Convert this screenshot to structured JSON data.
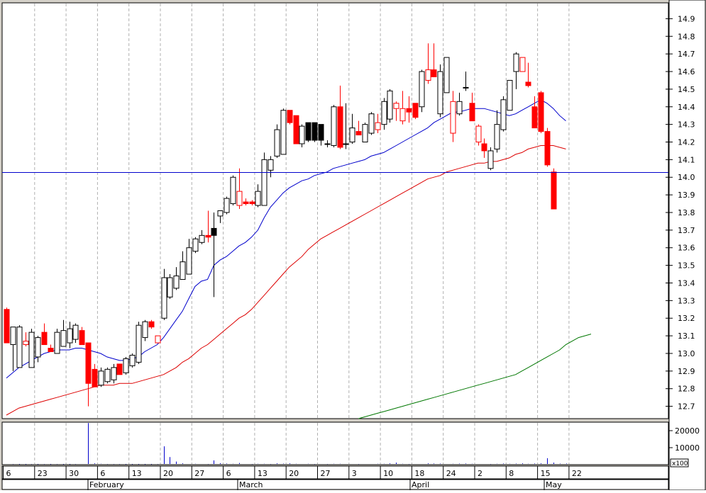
{
  "chart_data": {
    "type": "candlestick",
    "title": "",
    "grid": true,
    "price_axis": {
      "ylim": [
        12.63,
        14.99
      ],
      "ticks": [
        "14.9",
        "14.8",
        "14.7",
        "14.6",
        "14.5",
        "14.4",
        "14.3",
        "14.2",
        "14.1",
        "14.0",
        "13.9",
        "13.8",
        "13.7",
        "13.6",
        "13.5",
        "13.4",
        "13.3",
        "13.2",
        "13.1",
        "13.0",
        "12.9",
        "12.8",
        "12.7"
      ]
    },
    "volume_axis": {
      "ylim": [
        0,
        25000
      ],
      "ticks": [
        "20000",
        "10000"
      ],
      "multiplier_label": "x100"
    },
    "date_ticks": [
      "6",
      "23",
      "30",
      "6",
      "13",
      "20",
      "27",
      "6",
      "13",
      "20",
      "27",
      "3",
      "10",
      "18",
      "24",
      "2",
      "8",
      "15",
      "22"
    ],
    "month_labels": [
      "February",
      "March",
      "April",
      "May"
    ],
    "reference_line": {
      "value": 14.03,
      "color": "#0000cc"
    },
    "colors": {
      "up_candle": "#000000",
      "down_candle": "#ff0000",
      "ma_short": "#0000cc",
      "ma_mid": "#dd0000",
      "ma_long": "#007700",
      "volume": "#0000cc"
    },
    "candles": [
      {
        "o": 13.25,
        "h": 13.26,
        "l": 13.06,
        "c": 13.06,
        "col": "red",
        "fill": true
      },
      {
        "o": 13.05,
        "h": 13.15,
        "l": 12.9,
        "c": 13.15,
        "col": "black",
        "fill": false
      },
      {
        "o": 12.92,
        "h": 13.16,
        "l": 12.92,
        "c": 13.15,
        "col": "black",
        "fill": false
      },
      {
        "o": 13.07,
        "h": 13.12,
        "l": 13.04,
        "c": 13.05,
        "col": "red",
        "fill": false
      },
      {
        "o": 13.12,
        "h": 13.14,
        "l": 12.92,
        "c": 12.92,
        "col": "black",
        "fill": false
      },
      {
        "o": 12.98,
        "h": 13.1,
        "l": 12.95,
        "c": 13.09,
        "col": "black",
        "fill": false
      },
      {
        "o": 13.12,
        "h": 13.17,
        "l": 13.05,
        "c": 13.05,
        "col": "red",
        "fill": true
      },
      {
        "o": 13.03,
        "h": 13.05,
        "l": 13.01,
        "c": 13.01,
        "col": "red",
        "fill": true
      },
      {
        "o": 13.0,
        "h": 13.14,
        "l": 13.0,
        "c": 13.12,
        "col": "black",
        "fill": false
      },
      {
        "o": 13.04,
        "h": 13.19,
        "l": 13.04,
        "c": 13.13,
        "col": "black",
        "fill": false
      },
      {
        "o": 13.06,
        "h": 13.18,
        "l": 13.03,
        "c": 13.14,
        "col": "black",
        "fill": false
      },
      {
        "o": 13.08,
        "h": 13.17,
        "l": 13.06,
        "c": 13.16,
        "col": "black",
        "fill": false
      },
      {
        "o": 13.13,
        "h": 13.15,
        "l": 13.05,
        "c": 13.05,
        "col": "red",
        "fill": true
      },
      {
        "o": 13.06,
        "h": 13.06,
        "l": 12.7,
        "c": 12.83,
        "col": "red",
        "fill": true
      },
      {
        "o": 12.91,
        "h": 12.94,
        "l": 12.81,
        "c": 12.81,
        "col": "red",
        "fill": true
      },
      {
        "o": 12.82,
        "h": 12.92,
        "l": 12.81,
        "c": 12.9,
        "col": "black",
        "fill": false
      },
      {
        "o": 12.84,
        "h": 12.92,
        "l": 12.83,
        "c": 12.91,
        "col": "black",
        "fill": false
      },
      {
        "o": 12.85,
        "h": 12.94,
        "l": 12.83,
        "c": 12.92,
        "col": "black",
        "fill": false
      },
      {
        "o": 12.94,
        "h": 12.94,
        "l": 12.88,
        "c": 12.88,
        "col": "red",
        "fill": true
      },
      {
        "o": 12.89,
        "h": 12.98,
        "l": 12.88,
        "c": 12.97,
        "col": "black",
        "fill": false
      },
      {
        "o": 12.93,
        "h": 13.0,
        "l": 12.92,
        "c": 12.99,
        "col": "black",
        "fill": false
      },
      {
        "o": 12.95,
        "h": 13.18,
        "l": 12.94,
        "c": 13.16,
        "col": "black",
        "fill": false
      },
      {
        "o": 13.09,
        "h": 13.19,
        "l": 13.07,
        "c": 13.18,
        "col": "black",
        "fill": false
      },
      {
        "o": 13.18,
        "h": 13.19,
        "l": 13.14,
        "c": 13.15,
        "col": "red",
        "fill": true
      },
      {
        "o": 13.1,
        "h": 13.1,
        "l": 13.06,
        "c": 13.06,
        "col": "red",
        "fill": false
      },
      {
        "o": 13.2,
        "h": 13.48,
        "l": 13.19,
        "c": 13.43,
        "col": "black",
        "fill": false
      },
      {
        "o": 13.32,
        "h": 13.45,
        "l": 13.31,
        "c": 13.43,
        "col": "black",
        "fill": false
      },
      {
        "o": 13.37,
        "h": 13.49,
        "l": 13.36,
        "c": 13.44,
        "col": "black",
        "fill": false
      },
      {
        "o": 13.42,
        "h": 13.58,
        "l": 13.42,
        "c": 13.52,
        "col": "black",
        "fill": false
      },
      {
        "o": 13.45,
        "h": 13.65,
        "l": 13.45,
        "c": 13.6,
        "col": "black",
        "fill": false
      },
      {
        "o": 13.58,
        "h": 13.66,
        "l": 13.57,
        "c": 13.65,
        "col": "black",
        "fill": false
      },
      {
        "o": 13.63,
        "h": 13.7,
        "l": 13.62,
        "c": 13.67,
        "col": "black",
        "fill": false
      },
      {
        "o": 13.67,
        "h": 13.81,
        "l": 13.63,
        "c": 13.66,
        "col": "red",
        "fill": true
      },
      {
        "o": 13.67,
        "h": 13.8,
        "l": 13.32,
        "c": 13.71,
        "col": "black",
        "fill": true
      },
      {
        "o": 13.78,
        "h": 13.81,
        "l": 13.74,
        "c": 13.81,
        "col": "black",
        "fill": false
      },
      {
        "o": 13.8,
        "h": 13.89,
        "l": 13.79,
        "c": 13.88,
        "col": "black",
        "fill": false
      },
      {
        "o": 13.85,
        "h": 14.01,
        "l": 13.84,
        "c": 14.0,
        "col": "black",
        "fill": false
      },
      {
        "o": 13.92,
        "h": 14.05,
        "l": 13.82,
        "c": 13.84,
        "col": "red",
        "fill": false
      },
      {
        "o": 13.86,
        "h": 13.88,
        "l": 13.84,
        "c": 13.85,
        "col": "red",
        "fill": true
      },
      {
        "o": 13.86,
        "h": 13.87,
        "l": 13.84,
        "c": 13.85,
        "col": "red",
        "fill": true
      },
      {
        "o": 13.84,
        "h": 13.96,
        "l": 13.83,
        "c": 13.92,
        "col": "black",
        "fill": false
      },
      {
        "o": 13.84,
        "h": 14.14,
        "l": 13.84,
        "c": 14.1,
        "col": "black",
        "fill": false
      },
      {
        "o": 14.04,
        "h": 14.12,
        "l": 14.0,
        "c": 14.1,
        "col": "black",
        "fill": false
      },
      {
        "o": 14.12,
        "h": 14.3,
        "l": 14.11,
        "c": 14.27,
        "col": "black",
        "fill": false
      },
      {
        "o": 14.13,
        "h": 14.39,
        "l": 14.13,
        "c": 14.38,
        "col": "black",
        "fill": false
      },
      {
        "o": 14.38,
        "h": 14.38,
        "l": 14.3,
        "c": 14.31,
        "col": "red",
        "fill": true
      },
      {
        "o": 14.35,
        "h": 14.35,
        "l": 14.19,
        "c": 14.19,
        "col": "red",
        "fill": true
      },
      {
        "o": 14.19,
        "h": 14.3,
        "l": 14.17,
        "c": 14.29,
        "col": "black",
        "fill": false
      },
      {
        "o": 14.21,
        "h": 14.31,
        "l": 14.2,
        "c": 14.31,
        "col": "black",
        "fill": true
      },
      {
        "o": 14.21,
        "h": 14.31,
        "l": 14.2,
        "c": 14.31,
        "col": "black",
        "fill": true
      },
      {
        "o": 14.21,
        "h": 14.3,
        "l": 14.18,
        "c": 14.3,
        "col": "black",
        "fill": true
      },
      {
        "o": 14.19,
        "h": 14.21,
        "l": 14.17,
        "c": 14.19,
        "col": "black",
        "fill": true
      },
      {
        "o": 14.18,
        "h": 14.41,
        "l": 14.17,
        "c": 14.4,
        "col": "black",
        "fill": false
      },
      {
        "o": 14.4,
        "h": 14.52,
        "l": 14.16,
        "c": 14.17,
        "col": "red",
        "fill": true
      },
      {
        "o": 14.19,
        "h": 14.42,
        "l": 14.16,
        "c": 14.19,
        "col": "black",
        "fill": true
      },
      {
        "o": 14.2,
        "h": 14.36,
        "l": 14.19,
        "c": 14.28,
        "col": "black",
        "fill": false
      },
      {
        "o": 14.26,
        "h": 14.32,
        "l": 14.24,
        "c": 14.24,
        "col": "red",
        "fill": true
      },
      {
        "o": 14.2,
        "h": 14.31,
        "l": 14.2,
        "c": 14.3,
        "col": "black",
        "fill": false
      },
      {
        "o": 14.25,
        "h": 14.37,
        "l": 14.24,
        "c": 14.36,
        "col": "black",
        "fill": false
      },
      {
        "o": 14.27,
        "h": 14.36,
        "l": 14.25,
        "c": 14.31,
        "col": "red",
        "fill": false
      },
      {
        "o": 14.3,
        "h": 14.45,
        "l": 14.27,
        "c": 14.43,
        "col": "black",
        "fill": false
      },
      {
        "o": 14.33,
        "h": 14.5,
        "l": 14.31,
        "c": 14.49,
        "col": "black",
        "fill": false
      },
      {
        "o": 14.42,
        "h": 14.43,
        "l": 14.32,
        "c": 14.39,
        "col": "red",
        "fill": false
      },
      {
        "o": 14.39,
        "h": 14.49,
        "l": 14.3,
        "c": 14.32,
        "col": "red",
        "fill": false
      },
      {
        "o": 14.39,
        "h": 14.46,
        "l": 14.31,
        "c": 14.37,
        "col": "red",
        "fill": true
      },
      {
        "o": 14.42,
        "h": 14.42,
        "l": 14.33,
        "c": 14.34,
        "col": "red",
        "fill": true
      },
      {
        "o": 14.4,
        "h": 14.61,
        "l": 14.37,
        "c": 14.6,
        "col": "black",
        "fill": false
      },
      {
        "o": 14.61,
        "h": 14.76,
        "l": 14.53,
        "c": 14.55,
        "col": "red",
        "fill": false
      },
      {
        "o": 14.61,
        "h": 14.76,
        "l": 14.57,
        "c": 14.57,
        "col": "red",
        "fill": true
      },
      {
        "o": 14.36,
        "h": 14.64,
        "l": 14.34,
        "c": 14.6,
        "col": "black",
        "fill": false
      },
      {
        "o": 14.48,
        "h": 14.68,
        "l": 14.48,
        "c": 14.68,
        "col": "black",
        "fill": false
      },
      {
        "o": 14.43,
        "h": 14.49,
        "l": 14.2,
        "c": 14.25,
        "col": "red",
        "fill": false
      },
      {
        "o": 14.36,
        "h": 14.48,
        "l": 14.35,
        "c": 14.43,
        "col": "black",
        "fill": false
      },
      {
        "o": 14.51,
        "h": 14.6,
        "l": 14.49,
        "c": 14.51,
        "col": "black",
        "fill": false
      },
      {
        "o": 14.42,
        "h": 14.48,
        "l": 14.32,
        "c": 14.32,
        "col": "red",
        "fill": true
      },
      {
        "o": 14.29,
        "h": 14.3,
        "l": 14.18,
        "c": 14.2,
        "col": "red",
        "fill": false
      },
      {
        "o": 14.19,
        "h": 14.22,
        "l": 14.11,
        "c": 14.15,
        "col": "red",
        "fill": true
      },
      {
        "o": 14.05,
        "h": 14.17,
        "l": 14.04,
        "c": 14.15,
        "col": "black",
        "fill": false
      },
      {
        "o": 14.16,
        "h": 14.38,
        "l": 14.14,
        "c": 14.3,
        "col": "black",
        "fill": false
      },
      {
        "o": 14.27,
        "h": 14.46,
        "l": 14.26,
        "c": 14.44,
        "col": "black",
        "fill": false
      },
      {
        "o": 14.38,
        "h": 14.55,
        "l": 14.38,
        "c": 14.55,
        "col": "black",
        "fill": false
      },
      {
        "o": 14.6,
        "h": 14.71,
        "l": 14.5,
        "c": 14.7,
        "col": "black",
        "fill": false
      },
      {
        "o": 14.68,
        "h": 14.68,
        "l": 14.6,
        "c": 14.6,
        "col": "red",
        "fill": false
      },
      {
        "o": 14.54,
        "h": 14.65,
        "l": 14.51,
        "c": 14.52,
        "col": "red",
        "fill": true
      },
      {
        "o": 14.4,
        "h": 14.46,
        "l": 14.28,
        "c": 14.28,
        "col": "red",
        "fill": true
      },
      {
        "o": 14.48,
        "h": 14.49,
        "l": 14.25,
        "c": 14.26,
        "col": "red",
        "fill": true
      },
      {
        "o": 14.26,
        "h": 14.28,
        "l": 14.06,
        "c": 14.07,
        "col": "red",
        "fill": true
      },
      {
        "o": 14.03,
        "h": 14.05,
        "l": 13.82,
        "c": 13.82,
        "col": "red",
        "fill": true
      }
    ],
    "ma_short": [
      12.86,
      12.89,
      12.92,
      12.94,
      12.96,
      12.98,
      13.0,
      13.01,
      13.02,
      13.02,
      13.02,
      13.03,
      13.03,
      13.02,
      13.01,
      13.0,
      12.98,
      12.97,
      12.96,
      12.96,
      12.97,
      12.98,
      13.01,
      13.03,
      13.05,
      13.09,
      13.14,
      13.19,
      13.24,
      13.31,
      13.38,
      13.41,
      13.42,
      13.5,
      13.53,
      13.55,
      13.58,
      13.61,
      13.63,
      13.66,
      13.7,
      13.77,
      13.83,
      13.87,
      13.91,
      13.94,
      13.96,
      13.98,
      13.99,
      14.01,
      14.02,
      14.03,
      14.05,
      14.06,
      14.07,
      14.08,
      14.09,
      14.1,
      14.12,
      14.13,
      14.14,
      14.16,
      14.18,
      14.2,
      14.22,
      14.24,
      14.26,
      14.28,
      14.31,
      14.33,
      14.35,
      14.37,
      14.37,
      14.38,
      14.39,
      14.39,
      14.39,
      14.38,
      14.37,
      14.36,
      14.35,
      14.36,
      14.38,
      14.4,
      14.42,
      14.44,
      14.42,
      14.39,
      14.35,
      14.32
    ],
    "ma_mid": [
      12.65,
      12.67,
      12.69,
      12.7,
      12.71,
      12.72,
      12.73,
      12.74,
      12.75,
      12.76,
      12.77,
      12.78,
      12.79,
      12.8,
      12.81,
      12.82,
      12.82,
      12.82,
      12.83,
      12.83,
      12.83,
      12.84,
      12.85,
      12.86,
      12.87,
      12.88,
      12.9,
      12.92,
      12.95,
      12.97,
      13.0,
      13.03,
      13.05,
      13.08,
      13.11,
      13.14,
      13.17,
      13.2,
      13.22,
      13.25,
      13.29,
      13.33,
      13.37,
      13.41,
      13.45,
      13.49,
      13.52,
      13.55,
      13.59,
      13.62,
      13.65,
      13.67,
      13.69,
      13.71,
      13.73,
      13.75,
      13.77,
      13.79,
      13.81,
      13.83,
      13.85,
      13.87,
      13.89,
      13.91,
      13.93,
      13.95,
      13.97,
      13.99,
      14.0,
      14.01,
      14.03,
      14.04,
      14.05,
      14.06,
      14.07,
      14.08,
      14.08,
      14.09,
      14.09,
      14.1,
      14.11,
      14.13,
      14.14,
      14.16,
      14.17,
      14.18,
      14.18,
      14.18,
      14.17,
      14.16
    ],
    "ma_long": [
      null,
      null,
      null,
      null,
      null,
      null,
      null,
      null,
      null,
      null,
      null,
      null,
      null,
      null,
      null,
      null,
      null,
      null,
      null,
      null,
      null,
      null,
      null,
      null,
      null,
      null,
      null,
      null,
      null,
      null,
      null,
      null,
      null,
      null,
      null,
      null,
      null,
      null,
      null,
      null,
      null,
      null,
      null,
      null,
      null,
      null,
      null,
      null,
      null,
      null,
      null,
      null,
      null,
      null,
      null,
      null,
      12.63,
      12.64,
      12.65,
      12.66,
      12.67,
      12.68,
      12.69,
      12.7,
      12.71,
      12.72,
      12.73,
      12.74,
      12.75,
      12.76,
      12.77,
      12.78,
      12.79,
      12.8,
      12.81,
      12.82,
      12.83,
      12.84,
      12.85,
      12.86,
      12.87,
      12.88,
      12.9,
      12.92,
      12.94,
      12.96,
      12.98,
      13.0,
      13.02,
      13.05,
      13.07,
      13.09,
      13.1,
      13.11
    ],
    "volume": [
      400,
      300,
      200,
      200,
      300,
      200,
      300,
      200,
      300,
      200,
      200,
      300,
      400,
      24500,
      800,
      500,
      300,
      300,
      300,
      200,
      200,
      200,
      200,
      200,
      300,
      10800,
      4500,
      1800,
      800,
      400,
      500,
      400,
      300,
      2500,
      900,
      700,
      500,
      1000,
      400,
      300,
      500,
      500,
      300,
      800,
      600,
      800,
      500,
      400,
      500,
      300,
      400,
      300,
      500,
      500,
      400,
      400,
      300,
      400,
      400,
      500,
      500,
      800,
      1200,
      500,
      300,
      400,
      400,
      800,
      700,
      600,
      400,
      500,
      600,
      700,
      500,
      400,
      400,
      300,
      500,
      700,
      500,
      600,
      800,
      500,
      700,
      800,
      3800,
      1200,
      600,
      700
    ]
  }
}
